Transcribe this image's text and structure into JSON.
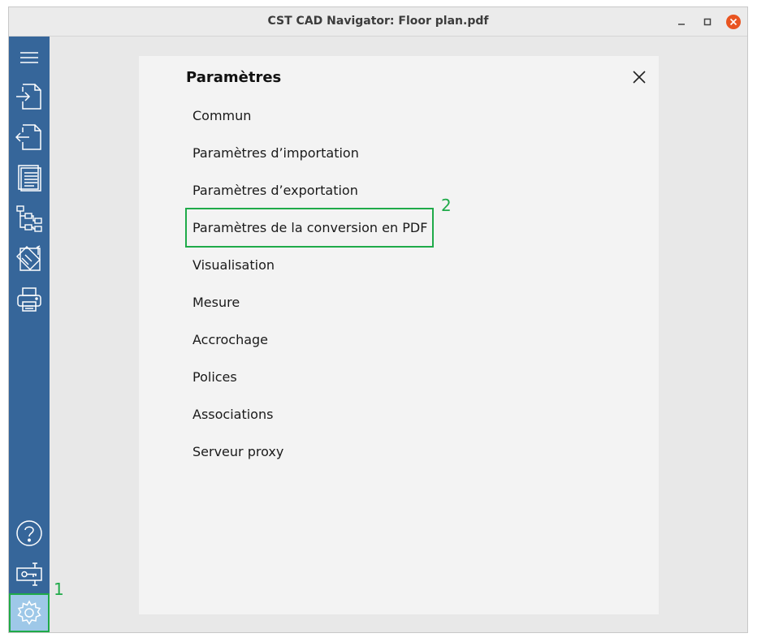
{
  "window": {
    "title": "CST CAD Navigator: Floor plan.pdf"
  },
  "sidebar": {
    "items": [
      {
        "icon": "hamburger-menu-icon"
      },
      {
        "icon": "import-file-icon"
      },
      {
        "icon": "export-file-icon"
      },
      {
        "icon": "document-list-icon"
      },
      {
        "icon": "layer-tree-icon"
      },
      {
        "icon": "drawing-tools-icon"
      },
      {
        "icon": "printer-icon"
      },
      {
        "icon": "help-icon"
      },
      {
        "icon": "license-key-icon"
      },
      {
        "icon": "settings-gear-icon"
      }
    ]
  },
  "settings": {
    "title": "Paramètres",
    "items": [
      "Commun",
      "Paramètres d’importation",
      "Paramètres d’exportation",
      "Paramètres de la conversion en PDF",
      "Visualisation",
      "Mesure",
      "Accrochage",
      "Polices",
      "Associations",
      "Serveur proxy"
    ]
  },
  "annotations": {
    "one": "1",
    "two": "2"
  },
  "colors": {
    "sidebar": "#36669a",
    "active_item": "#9ec8e8",
    "highlight": "#1faa49",
    "close_button": "#e95420"
  }
}
